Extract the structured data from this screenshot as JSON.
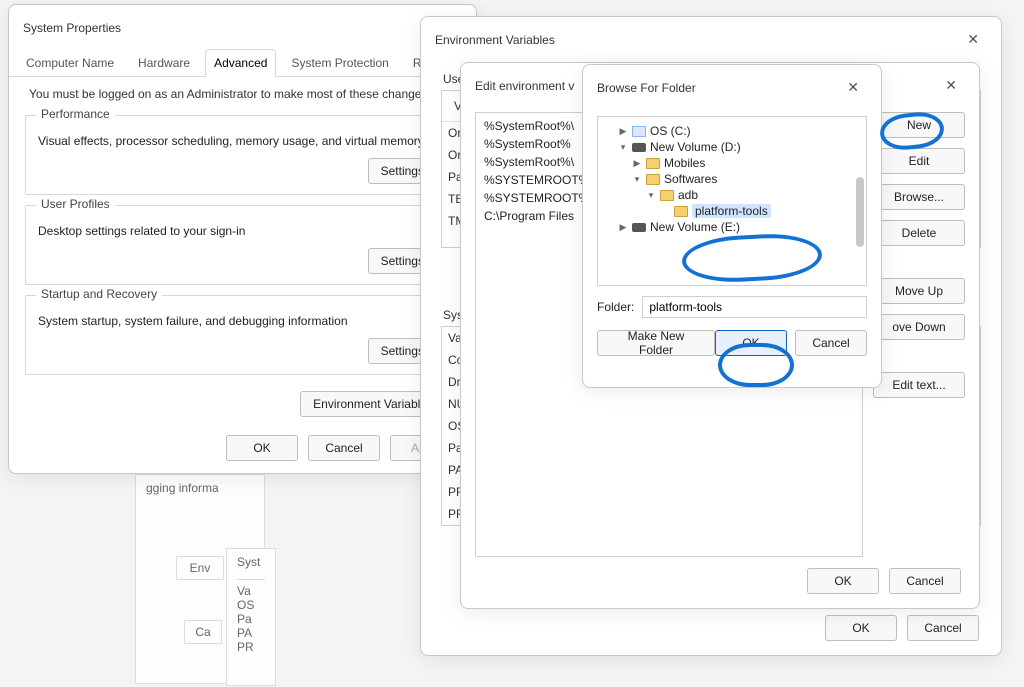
{
  "sysprops": {
    "title": "System Properties",
    "tabs": [
      "Computer Name",
      "Hardware",
      "Advanced",
      "System Protection",
      "Remote"
    ],
    "active_tab": "Advanced",
    "note": "You must be logged on as an Administrator to make most of these changes.",
    "perf_title": "Performance",
    "perf_desc": "Visual effects, processor scheduling, memory usage, and virtual memory",
    "profiles_title": "User Profiles",
    "profiles_desc": "Desktop settings related to your sign-in",
    "startup_title": "Startup and Recovery",
    "startup_desc": "System startup, system failure, and debugging information",
    "settings_label": "Settings...",
    "envvars_label": "Environment Variables...",
    "ok_label": "OK",
    "cancel_label": "Cancel",
    "apply_label": "Apply"
  },
  "envvars": {
    "title": "Environment Variables",
    "user_section": "User",
    "sys_section": "Syst",
    "head_cols": [
      "Va"
    ],
    "user_rows_first_letters": [
      "Or",
      "Or",
      "Pa",
      "TE",
      "TM"
    ],
    "sys_rows_first_letters": [
      "Va",
      "Co",
      "Dr",
      "NU",
      "OS",
      "Pa",
      "PA",
      "PR",
      "PR"
    ],
    "ok_label": "OK",
    "cancel_label": "Cancel"
  },
  "editenv": {
    "title": "Edit environment v",
    "items": [
      "%SystemRoot%\\",
      "%SystemRoot%",
      "%SystemRoot%\\",
      "%SYSTEMROOT%",
      "%SYSTEMROOT%",
      "C:\\Program Files"
    ],
    "btn_new": "New",
    "btn_edit": "Edit",
    "btn_browse": "Browse...",
    "btn_delete": "Delete",
    "btn_moveup": "Move Up",
    "btn_movedown": "ove Down",
    "btn_edittext": "Edit text...",
    "ok_label": "OK",
    "cancel_label": "Cancel"
  },
  "browse": {
    "title": "Browse For Folder",
    "nodes": {
      "os": "OS (C:)",
      "d": "New Volume (D:)",
      "mobiles": "Mobiles",
      "softwares": "Softwares",
      "adb": "adb",
      "platform_tools": "platform-tools",
      "e": "New Volume (E:)"
    },
    "folder_label": "Folder:",
    "folder_value": "platform-tools",
    "make_new": "Make New Folder",
    "ok_label": "OK",
    "cancel_label": "Cancel"
  },
  "ghost": {
    "sysprops_fragment": "gging informa",
    "env_btn_fragment": "Env",
    "cancel_fragment": "Ca",
    "syst_label": "Syst",
    "rows": [
      "Va",
      "OS",
      "Pa",
      "PA",
      "PR"
    ]
  }
}
